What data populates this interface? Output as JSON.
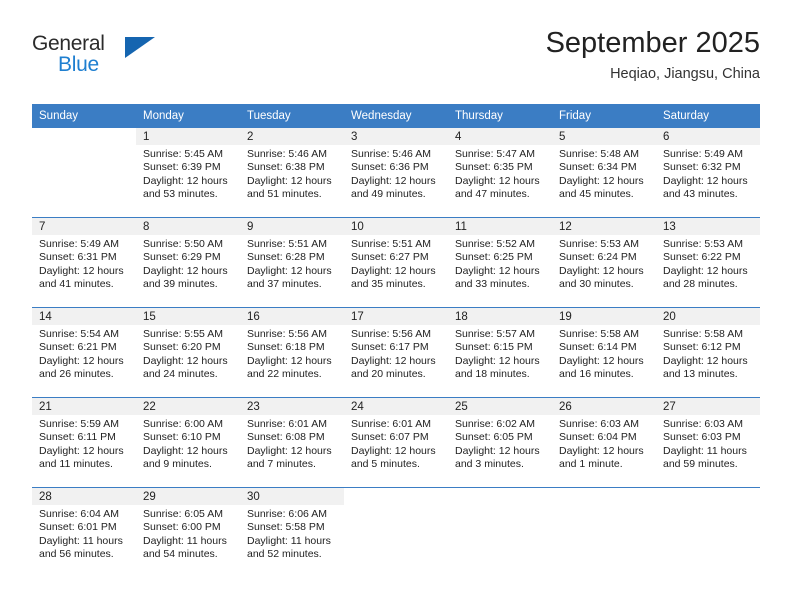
{
  "brand": {
    "name_part1": "General",
    "name_part2": "Blue",
    "logo_icon": "triangle-logo-icon"
  },
  "header": {
    "month_title": "September 2025",
    "location": "Heqiao, Jiangsu, China"
  },
  "calendar": {
    "weekday_headers": [
      "Sunday",
      "Monday",
      "Tuesday",
      "Wednesday",
      "Thursday",
      "Friday",
      "Saturday"
    ],
    "accent_color": "#3b7dc4",
    "daynum_bg": "#f1f1f1",
    "weeks": [
      [
        {
          "day": "",
          "empty": true
        },
        {
          "day": "1",
          "sunrise": "Sunrise: 5:45 AM",
          "sunset": "Sunset: 6:39 PM",
          "daylight1": "Daylight: 12 hours",
          "daylight2": "and 53 minutes."
        },
        {
          "day": "2",
          "sunrise": "Sunrise: 5:46 AM",
          "sunset": "Sunset: 6:38 PM",
          "daylight1": "Daylight: 12 hours",
          "daylight2": "and 51 minutes."
        },
        {
          "day": "3",
          "sunrise": "Sunrise: 5:46 AM",
          "sunset": "Sunset: 6:36 PM",
          "daylight1": "Daylight: 12 hours",
          "daylight2": "and 49 minutes."
        },
        {
          "day": "4",
          "sunrise": "Sunrise: 5:47 AM",
          "sunset": "Sunset: 6:35 PM",
          "daylight1": "Daylight: 12 hours",
          "daylight2": "and 47 minutes."
        },
        {
          "day": "5",
          "sunrise": "Sunrise: 5:48 AM",
          "sunset": "Sunset: 6:34 PM",
          "daylight1": "Daylight: 12 hours",
          "daylight2": "and 45 minutes."
        },
        {
          "day": "6",
          "sunrise": "Sunrise: 5:49 AM",
          "sunset": "Sunset: 6:32 PM",
          "daylight1": "Daylight: 12 hours",
          "daylight2": "and 43 minutes."
        }
      ],
      [
        {
          "day": "7",
          "sunrise": "Sunrise: 5:49 AM",
          "sunset": "Sunset: 6:31 PM",
          "daylight1": "Daylight: 12 hours",
          "daylight2": "and 41 minutes."
        },
        {
          "day": "8",
          "sunrise": "Sunrise: 5:50 AM",
          "sunset": "Sunset: 6:29 PM",
          "daylight1": "Daylight: 12 hours",
          "daylight2": "and 39 minutes."
        },
        {
          "day": "9",
          "sunrise": "Sunrise: 5:51 AM",
          "sunset": "Sunset: 6:28 PM",
          "daylight1": "Daylight: 12 hours",
          "daylight2": "and 37 minutes."
        },
        {
          "day": "10",
          "sunrise": "Sunrise: 5:51 AM",
          "sunset": "Sunset: 6:27 PM",
          "daylight1": "Daylight: 12 hours",
          "daylight2": "and 35 minutes."
        },
        {
          "day": "11",
          "sunrise": "Sunrise: 5:52 AM",
          "sunset": "Sunset: 6:25 PM",
          "daylight1": "Daylight: 12 hours",
          "daylight2": "and 33 minutes."
        },
        {
          "day": "12",
          "sunrise": "Sunrise: 5:53 AM",
          "sunset": "Sunset: 6:24 PM",
          "daylight1": "Daylight: 12 hours",
          "daylight2": "and 30 minutes."
        },
        {
          "day": "13",
          "sunrise": "Sunrise: 5:53 AM",
          "sunset": "Sunset: 6:22 PM",
          "daylight1": "Daylight: 12 hours",
          "daylight2": "and 28 minutes."
        }
      ],
      [
        {
          "day": "14",
          "sunrise": "Sunrise: 5:54 AM",
          "sunset": "Sunset: 6:21 PM",
          "daylight1": "Daylight: 12 hours",
          "daylight2": "and 26 minutes."
        },
        {
          "day": "15",
          "sunrise": "Sunrise: 5:55 AM",
          "sunset": "Sunset: 6:20 PM",
          "daylight1": "Daylight: 12 hours",
          "daylight2": "and 24 minutes."
        },
        {
          "day": "16",
          "sunrise": "Sunrise: 5:56 AM",
          "sunset": "Sunset: 6:18 PM",
          "daylight1": "Daylight: 12 hours",
          "daylight2": "and 22 minutes."
        },
        {
          "day": "17",
          "sunrise": "Sunrise: 5:56 AM",
          "sunset": "Sunset: 6:17 PM",
          "daylight1": "Daylight: 12 hours",
          "daylight2": "and 20 minutes."
        },
        {
          "day": "18",
          "sunrise": "Sunrise: 5:57 AM",
          "sunset": "Sunset: 6:15 PM",
          "daylight1": "Daylight: 12 hours",
          "daylight2": "and 18 minutes."
        },
        {
          "day": "19",
          "sunrise": "Sunrise: 5:58 AM",
          "sunset": "Sunset: 6:14 PM",
          "daylight1": "Daylight: 12 hours",
          "daylight2": "and 16 minutes."
        },
        {
          "day": "20",
          "sunrise": "Sunrise: 5:58 AM",
          "sunset": "Sunset: 6:12 PM",
          "daylight1": "Daylight: 12 hours",
          "daylight2": "and 13 minutes."
        }
      ],
      [
        {
          "day": "21",
          "sunrise": "Sunrise: 5:59 AM",
          "sunset": "Sunset: 6:11 PM",
          "daylight1": "Daylight: 12 hours",
          "daylight2": "and 11 minutes."
        },
        {
          "day": "22",
          "sunrise": "Sunrise: 6:00 AM",
          "sunset": "Sunset: 6:10 PM",
          "daylight1": "Daylight: 12 hours",
          "daylight2": "and 9 minutes."
        },
        {
          "day": "23",
          "sunrise": "Sunrise: 6:01 AM",
          "sunset": "Sunset: 6:08 PM",
          "daylight1": "Daylight: 12 hours",
          "daylight2": "and 7 minutes."
        },
        {
          "day": "24",
          "sunrise": "Sunrise: 6:01 AM",
          "sunset": "Sunset: 6:07 PM",
          "daylight1": "Daylight: 12 hours",
          "daylight2": "and 5 minutes."
        },
        {
          "day": "25",
          "sunrise": "Sunrise: 6:02 AM",
          "sunset": "Sunset: 6:05 PM",
          "daylight1": "Daylight: 12 hours",
          "daylight2": "and 3 minutes."
        },
        {
          "day": "26",
          "sunrise": "Sunrise: 6:03 AM",
          "sunset": "Sunset: 6:04 PM",
          "daylight1": "Daylight: 12 hours",
          "daylight2": "and 1 minute."
        },
        {
          "day": "27",
          "sunrise": "Sunrise: 6:03 AM",
          "sunset": "Sunset: 6:03 PM",
          "daylight1": "Daylight: 11 hours",
          "daylight2": "and 59 minutes."
        }
      ],
      [
        {
          "day": "28",
          "sunrise": "Sunrise: 6:04 AM",
          "sunset": "Sunset: 6:01 PM",
          "daylight1": "Daylight: 11 hours",
          "daylight2": "and 56 minutes."
        },
        {
          "day": "29",
          "sunrise": "Sunrise: 6:05 AM",
          "sunset": "Sunset: 6:00 PM",
          "daylight1": "Daylight: 11 hours",
          "daylight2": "and 54 minutes."
        },
        {
          "day": "30",
          "sunrise": "Sunrise: 6:06 AM",
          "sunset": "Sunset: 5:58 PM",
          "daylight1": "Daylight: 11 hours",
          "daylight2": "and 52 minutes."
        },
        {
          "day": "",
          "blank": true
        },
        {
          "day": "",
          "blank": true
        },
        {
          "day": "",
          "blank": true
        },
        {
          "day": "",
          "blank": true
        }
      ]
    ]
  }
}
